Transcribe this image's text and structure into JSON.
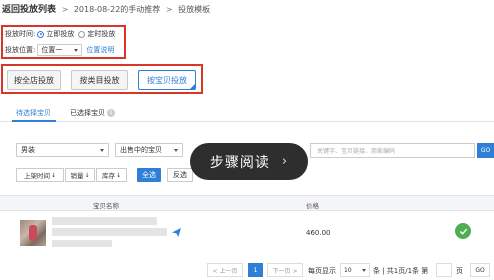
{
  "breadcrumb": {
    "back": "返回投放列表",
    "date_title": "2018-08-22的手动推荐",
    "template": "投放模板"
  },
  "settings": {
    "time_label": "投放时间:",
    "time_options": [
      "立即投放",
      "定时投放"
    ],
    "position_label": "投放位置:",
    "position_value": "位置一",
    "position_help": "位置说明"
  },
  "mode_buttons": [
    "按全店投放",
    "按类目投放",
    "按宝贝投放"
  ],
  "tabs": {
    "pending": "待选择宝贝",
    "selected": "已选择宝贝",
    "selected_count": "1"
  },
  "filters": {
    "category": "男装",
    "status": "出售中的宝贝",
    "search_placeholder": "关键字、宝贝链接、商家编码",
    "go": "GO"
  },
  "sort": {
    "listing_time": "上架时间",
    "sales": "销量",
    "stock": "库存",
    "select_all": "全选",
    "invert": "反选"
  },
  "table": {
    "col_name": "宝贝名称",
    "col_price": "价格",
    "rows": [
      {
        "price": "460.00"
      }
    ]
  },
  "pagination": {
    "prev": "< 上一页",
    "current_page": "1",
    "next": "下一页 >",
    "per_page_label": "每页显示",
    "per_page_value": "10",
    "summary": "条 | 共1页/1条 第",
    "page_unit": "页",
    "go": "GO"
  },
  "overlay": {
    "text": "步骤阅读"
  },
  "colors": {
    "accent": "#2f7fd7",
    "highlight_border": "#d9362a",
    "success": "#4cb050"
  }
}
